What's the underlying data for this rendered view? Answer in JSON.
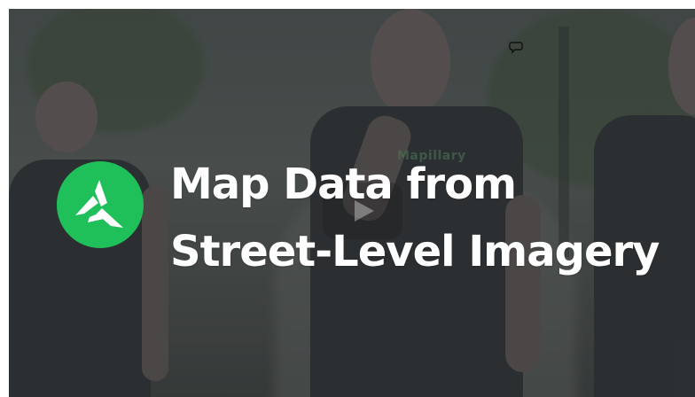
{
  "video": {
    "title_line1": "Map Data from",
    "title_line2": "Street-Level Imagery",
    "shirt_brand": "Mapillary",
    "logo_icon": "mapillary-logo-icon",
    "play_icon": "play-icon",
    "comment_icon": "speech-bubble-icon"
  },
  "colors": {
    "brand_green": "#1fbf5a",
    "title_text": "#ffffff"
  }
}
